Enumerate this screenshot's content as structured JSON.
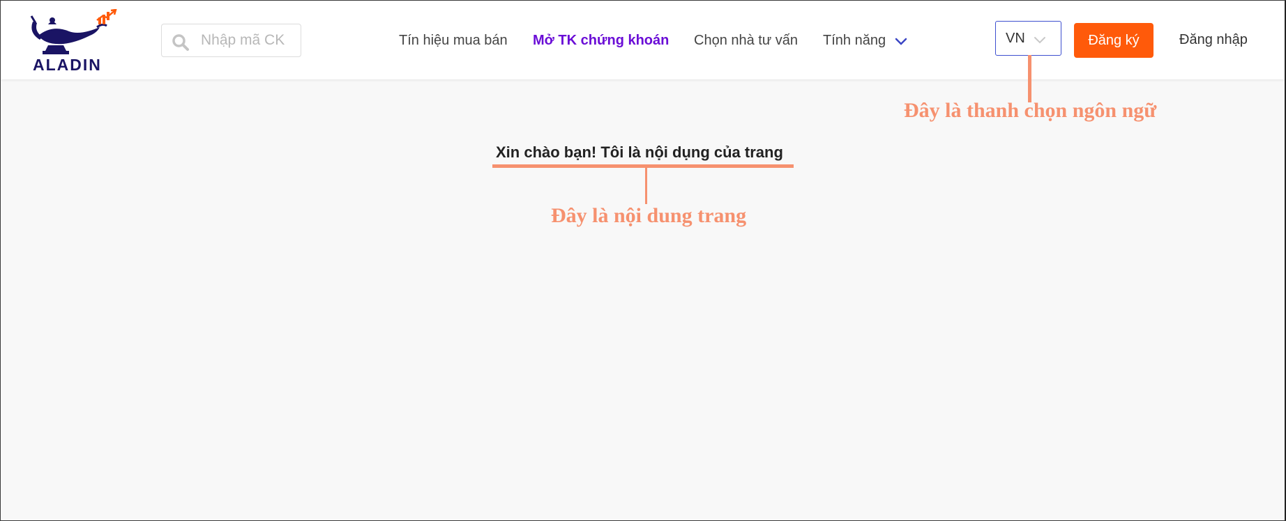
{
  "header": {
    "logo_text": "ALADIN",
    "search": {
      "placeholder": "Nhập mã CK",
      "value": ""
    },
    "nav": [
      {
        "label": "Tín hiệu mua bán",
        "highlight": false
      },
      {
        "label": "Mở TK chứng khoán",
        "highlight": true
      },
      {
        "label": "Chọn nhà tư vấn",
        "highlight": false
      },
      {
        "label": "Tính năng",
        "highlight": false
      }
    ],
    "language": {
      "selected": "VN"
    },
    "register_label": "Đăng ký",
    "login_label": "Đăng nhập"
  },
  "main": {
    "greeting": "Xin chào bạn! Tôi là nội dụng của trang"
  },
  "annotations": {
    "language_bar": "Đây là thanh chọn ngôn ngữ",
    "page_content": "Đây là nội dung trang"
  },
  "colors": {
    "brand_navy": "#1a1464",
    "accent_orange": "#ff5a0a",
    "highlight_purple": "#6a0dd6",
    "annotation": "#f6916f",
    "select_border": "#3d4fcf"
  }
}
